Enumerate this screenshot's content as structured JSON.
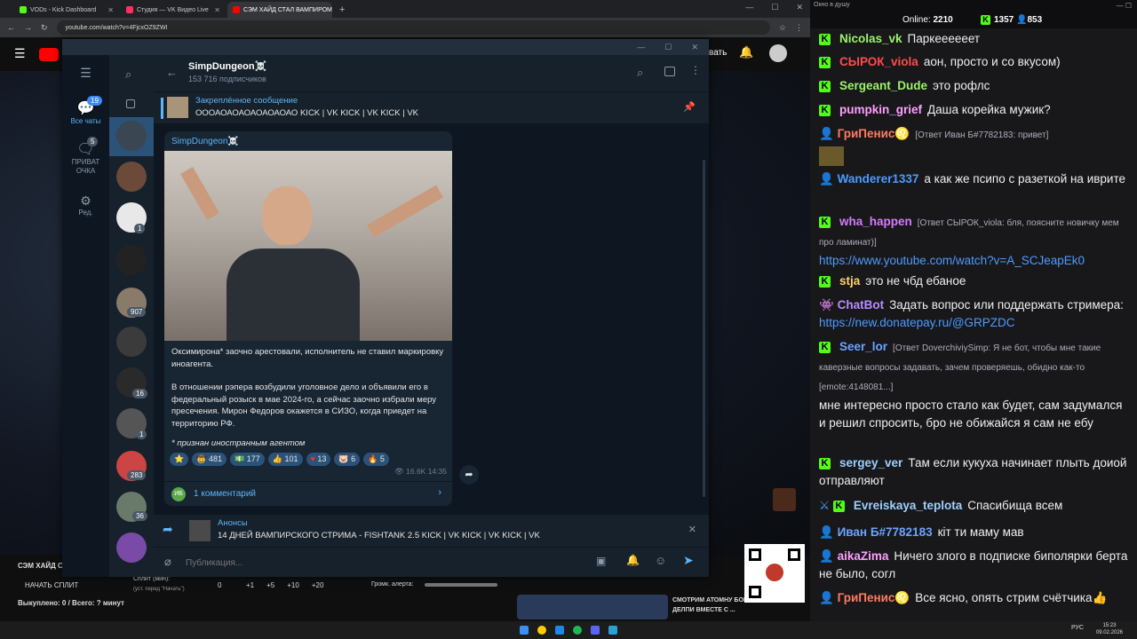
{
  "browser": {
    "tabs": [
      {
        "title": "VODs - Kick Dashboard",
        "color": "#53fc18"
      },
      {
        "title": "Студия — VK Видео Live",
        "color": "#ff2e63"
      },
      {
        "title": "СЭМ ХАЙД СТАЛ ВАМПИРОМ",
        "color": "#ff0000"
      }
    ],
    "url": "youtube.com/watch?v=4FjcxOZ9ZWI",
    "window_title": "Окно в душу"
  },
  "youtube": {
    "title_left": "СЭМ ХАЙД С",
    "start_split": "НАЧАТЬ СПЛИТ",
    "split_min": "Сплит (мин):",
    "split_note": "(уст. перед \"Начать\")",
    "split_value": "0",
    "split_buttons": [
      "+1",
      "+5",
      "+10",
      "+20"
    ],
    "alert_volume": "Громк. алерта:",
    "done": "Выкуплено: 0 / Всего: ? минут",
    "sub_label": "вать",
    "card_title": "СМОТРИМ АТОМНУ БОМБУ ДЕЛПИ ВМЕСТЕ С ..."
  },
  "telegram": {
    "rail": [
      {
        "label": "Все чаты",
        "badge": "19"
      },
      {
        "label": "ПРИВАТ ОЧКА",
        "badge": "5"
      },
      {
        "label": "Ред.",
        "badge": ""
      }
    ],
    "chat_badges": [
      "1",
      "907",
      "16",
      "1",
      "283",
      "36"
    ],
    "channel": {
      "name": "SimpDungeon☠️",
      "subscribers": "153 716 подписчиков"
    },
    "pinned": {
      "title": "Закреплённое сообщение",
      "text": "ОООАОАОАОАОАОАОАО  KICK | VK KICK | VK KICK | VK"
    },
    "post": {
      "author": "SimpDungeon☠️",
      "p1": "Оксимирона* заочно арестовали, исполнитель не ставил маркировку иноагента.",
      "p2": "В отношении рэпера возбудили уголовное дело и объявили его в федеральный розыск в мае 2024-го, а сейчас заочно избрали меру пресечения. Мирон Федоров окажется в СИЗО, когда приедет на территорию РФ.",
      "note": "* признан иностранным агентом",
      "reactions": [
        {
          "emoji": "⭐",
          "count": ""
        },
        {
          "emoji": "🤠",
          "count": "481"
        },
        {
          "emoji": "💵",
          "count": "177"
        },
        {
          "emoji": "👍",
          "count": "101"
        },
        {
          "emoji": "♥",
          "count": "13"
        },
        {
          "emoji": "🐷",
          "count": "6"
        },
        {
          "emoji": "🔥",
          "count": "5"
        }
      ],
      "views": "16.6K",
      "time": "14:35",
      "comments": "1 комментарий"
    },
    "reply": {
      "title": "Анонсы",
      "text": "14 ДНЕЙ ВАМПИРСКОГО СТРИМА - FISHTANK 2.5  KICK | VK KICK | VK KICK | VK"
    },
    "compose_placeholder": "Публикация..."
  },
  "chat": {
    "online_label": "Online:",
    "online": "2210",
    "kick_count": "1357",
    "other_count": "853",
    "messages": [
      {
        "nick": "Nicolas_vk",
        "color": "#9cf36a",
        "text": "Паркеееееет"
      },
      {
        "nick": "СЫРОК_viola",
        "color": "#ff4b4b",
        "text": "аон, просто и со вкусом)"
      },
      {
        "nick": "Sergeant_Dude",
        "color": "#9cf36a",
        "text": "это рофлс"
      },
      {
        "nick": "pumpkin_grief",
        "color": "#ff9fff",
        "text": "Даша корейка мужик?"
      },
      {
        "nick": "ГриПенис♌",
        "color": "#ff7b61",
        "text": "[Ответ Иван Б#7782183: привет]"
      },
      {
        "nick": "Wanderer1337",
        "color": "#4d9bff",
        "text": "а как же псипо с разеткой на иврите"
      },
      {
        "nick": "wha_happen",
        "color": "#d67bff",
        "text": "[Ответ СЫРОК_viola: бля, поясните новичку мем про ламинат)]",
        "link": "https://www.youtube.com/watch?v=A_SCJeapEk0"
      },
      {
        "nick": "stja",
        "color": "#ffd36b",
        "text": "это не чбд ебаное"
      },
      {
        "nick": "ChatBot",
        "color": "#b98bff",
        "text": "Задать вопрос или поддержать стримера:",
        "link": "https://new.donatepay.ru/@GRPZDC"
      },
      {
        "nick": "Seer_lor",
        "color": "#6ba3ff",
        "text": "[Ответ DoverchiviySimp: Я не бот, чтобы мне такие каверзные вопросы задавать, зачем проверяешь, обидно как-то [emote:4148081...]",
        "text2": "мне интересно просто стало как будет, сам задумался и решил спросить, бро не обижайся я сам не ебу"
      },
      {
        "nick": "sergey_ver",
        "color": "#9cd0ff",
        "text": "Там если кукуха начинает плыть доиой отправляют"
      },
      {
        "nick": "Evreiskaya_teplota",
        "color": "#9cd0ff",
        "text": "Спасибища всем"
      },
      {
        "nick": "Иван Б#7782183",
        "color": "#6ba3ff",
        "text": "кіт ти маму мав"
      },
      {
        "nick": "aikaZima",
        "color": "#ff9fff",
        "text": "Ничего злого в подписке биполярки берта не было, согл"
      },
      {
        "nick": "ГриПенис♌",
        "color": "#ff7b61",
        "text": "Все ясно, опять стрим счётчика👍"
      }
    ]
  },
  "taskbar": {
    "lang": "РУС",
    "time": "15:23",
    "date": "09.02.2026"
  }
}
